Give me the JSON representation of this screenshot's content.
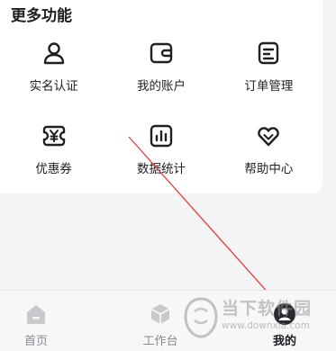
{
  "section": {
    "title": "更多功能"
  },
  "features": [
    {
      "label": "实名认证",
      "icon": "person-icon"
    },
    {
      "label": "我的账户",
      "icon": "wallet-icon"
    },
    {
      "label": "订单管理",
      "icon": "order-doc-icon"
    },
    {
      "label": "优惠券",
      "icon": "coupon-icon"
    },
    {
      "label": "数据统计",
      "icon": "bar-chart-icon"
    },
    {
      "label": "帮助中心",
      "icon": "heart-icon"
    }
  ],
  "tabbar": {
    "tabs": [
      {
        "label": "首页",
        "icon": "home-icon",
        "active": false
      },
      {
        "label": "工作台",
        "icon": "workbench-cube-icon",
        "active": false
      },
      {
        "label": "我的",
        "icon": "profile-icon",
        "active": true
      }
    ]
  },
  "watermark": {
    "line1": "当下软件园",
    "line2": "www.downxia.com"
  },
  "colors": {
    "annotation_arrow": "#e53935",
    "active_tab": "#1b1b20",
    "inactive_tab": "#8a8a90"
  }
}
